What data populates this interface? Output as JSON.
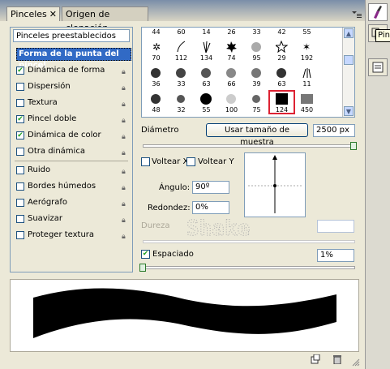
{
  "tabs": [
    {
      "label": "Pinceles",
      "close": "✕",
      "active": true
    },
    {
      "label": "Origen de clonación",
      "active": false
    }
  ],
  "panel_menu_icon": "menu-icon",
  "left": {
    "preset_label": "Pinceles preestablecidos",
    "items": [
      {
        "label": "Forma de la punta del pincel",
        "checkbox": false,
        "highlight": true
      },
      {
        "label": "Dinámica de forma",
        "checked": true
      },
      {
        "label": "Dispersión",
        "checked": false
      },
      {
        "label": "Textura",
        "checked": false
      },
      {
        "label": "Pincel doble",
        "checked": true
      },
      {
        "label": "Dinámica de color",
        "checked": true
      },
      {
        "label": "Otra dinámica",
        "checked": false
      },
      {
        "label": "Ruido",
        "checked": false
      },
      {
        "label": "Bordes húmedos",
        "checked": false
      },
      {
        "label": "Aerógrafo",
        "checked": false
      },
      {
        "label": "Suavizar",
        "checked": false
      },
      {
        "label": "Proteger textura",
        "checked": false
      }
    ]
  },
  "brushes": {
    "header": [
      "44",
      "60",
      "14",
      "26",
      "33",
      "42",
      "55"
    ],
    "rows": [
      [
        "70",
        "112",
        "134",
        "74",
        "95",
        "29",
        "192"
      ],
      [
        "36",
        "33",
        "63",
        "66",
        "39",
        "63",
        "11"
      ],
      [
        "48",
        "32",
        "55",
        "100",
        "75",
        "124",
        "450"
      ]
    ],
    "selected": "124"
  },
  "diameter": {
    "label": "Diámetro",
    "sample_button": "Usar tamaño de muestra",
    "value": "2500 px",
    "slider_fraction": 1.0
  },
  "flip": {
    "x_label": "Voltear X",
    "y_label": "Voltear Y"
  },
  "angle": {
    "label": "Ángulo:",
    "value": "90º"
  },
  "roundness": {
    "label": "Redondez:",
    "value": "0%"
  },
  "hardness": {
    "label": "Dureza",
    "value": ""
  },
  "spacing": {
    "label": "Espaciado",
    "checked": true,
    "value": "1%",
    "slider_fraction": 0.0
  },
  "tooltip": "Pincel",
  "sidebar_icons": [
    "brush-icon",
    "clone-source-icon",
    "document-icon"
  ],
  "footer": {
    "new_icon": "new-preset-icon",
    "trash_icon": "trash-icon"
  },
  "colors": {
    "highlight": "#316ac5",
    "selected_brush": "#dd2233",
    "check": "#21a121"
  }
}
